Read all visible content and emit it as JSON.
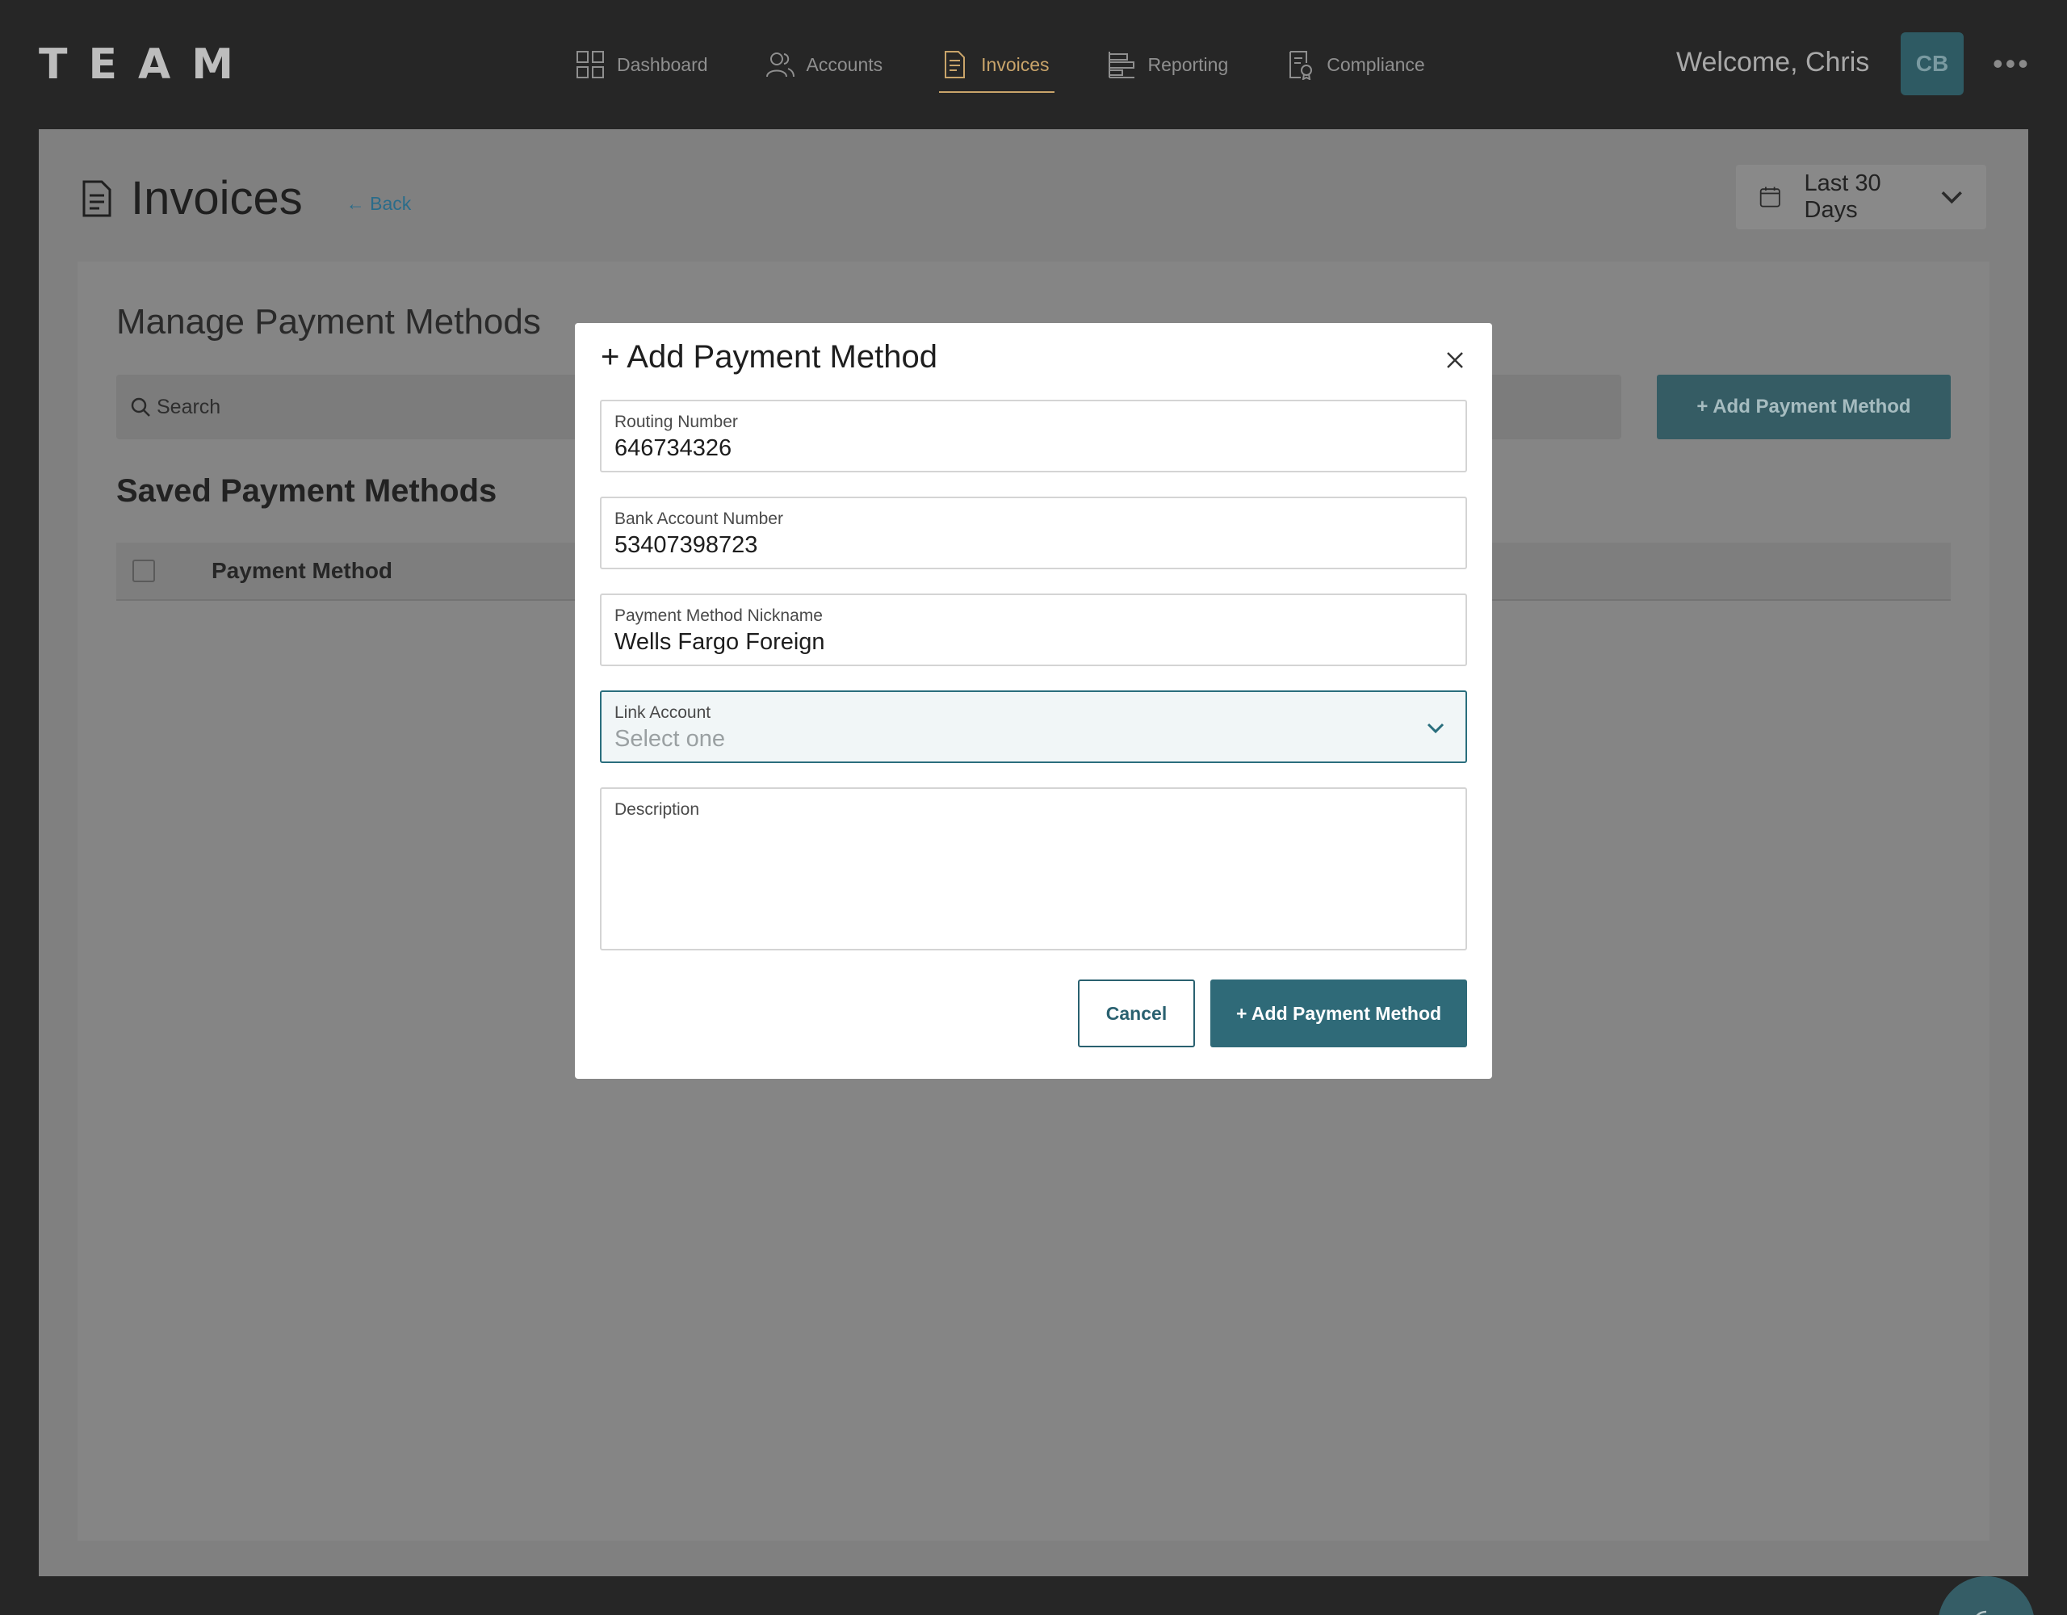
{
  "app": {
    "logo": "TEAM"
  },
  "nav": {
    "items": [
      {
        "label": "Dashboard",
        "icon": "grid-icon"
      },
      {
        "label": "Accounts",
        "icon": "users-icon"
      },
      {
        "label": "Invoices",
        "icon": "document-icon",
        "active": true
      },
      {
        "label": "Reporting",
        "icon": "bar-chart-icon"
      },
      {
        "label": "Compliance",
        "icon": "compliance-icon"
      }
    ]
  },
  "user": {
    "welcome": "Welcome, Chris",
    "initials": "CB",
    "more": "•••"
  },
  "page": {
    "title": "Invoices",
    "back": "← Back"
  },
  "date_filter": {
    "label": "Last 30 Days"
  },
  "manage": {
    "title": "Manage Payment Methods",
    "search_placeholder": "Search",
    "add_button": "+ Add Payment Method",
    "saved_title": "Saved Payment Methods",
    "table_columns": [
      "Payment Method"
    ]
  },
  "modal": {
    "title": "+ Add Payment Method",
    "fields": {
      "routing": {
        "label": "Routing Number",
        "value": "646734326"
      },
      "account": {
        "label": "Bank Account Number",
        "value": "53407398723"
      },
      "nickname": {
        "label": "Payment Method Nickname",
        "value": "Wells Fargo Foreign"
      },
      "link": {
        "label": "Link Account",
        "placeholder": "Select one"
      },
      "description": {
        "label": "Description",
        "value": ""
      }
    },
    "cancel": "Cancel",
    "submit": "+ Add Payment Method"
  },
  "colors": {
    "accent": "#2f6a78",
    "nav_active": "#c9a46a",
    "overlay_bg": "#808080",
    "topbar": "#262626"
  }
}
